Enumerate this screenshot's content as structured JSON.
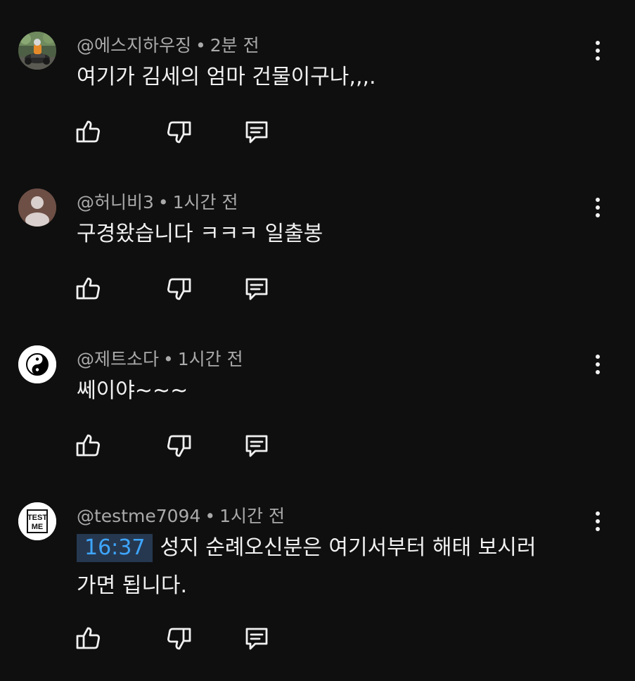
{
  "comments": [
    {
      "author": "@에스지하우징",
      "separator": "•",
      "time": "2분 전",
      "text": "여기가 김세의 엄마 건물이구나,,,.",
      "avatar_icon": "motorcycle-rider-photo"
    },
    {
      "author": "@허니비3",
      "separator": "•",
      "time": "1시간 전",
      "text": "구경왔습니다 ㅋㅋㅋ 일출봉",
      "avatar_icon": "default-person-icon"
    },
    {
      "author": "@제트소다",
      "separator": "•",
      "time": "1시간 전",
      "text": "쎄이야~~~",
      "avatar_icon": "yin-yang-icon"
    },
    {
      "author": "@testme7094",
      "separator": "•",
      "time": "1시간 전",
      "timestamp_link": "16:37",
      "text_line1": "성지 순례오신분은 여기서부터 해태 보시러",
      "text_line2": "가면 됩니다.",
      "avatar_text_top": "TEST",
      "avatar_text_bottom": "ME"
    }
  ],
  "icons": {
    "like": "thumbs-up-icon",
    "dislike": "thumbs-down-icon",
    "reply": "reply-comment-icon",
    "more": "more-vertical-icon"
  },
  "colors": {
    "background": "#0f0f0f",
    "text": "#f1f1f1",
    "meta": "#aaaaaa",
    "timestamp_link": "#3ea6ff",
    "timestamp_bg": "#263850"
  }
}
